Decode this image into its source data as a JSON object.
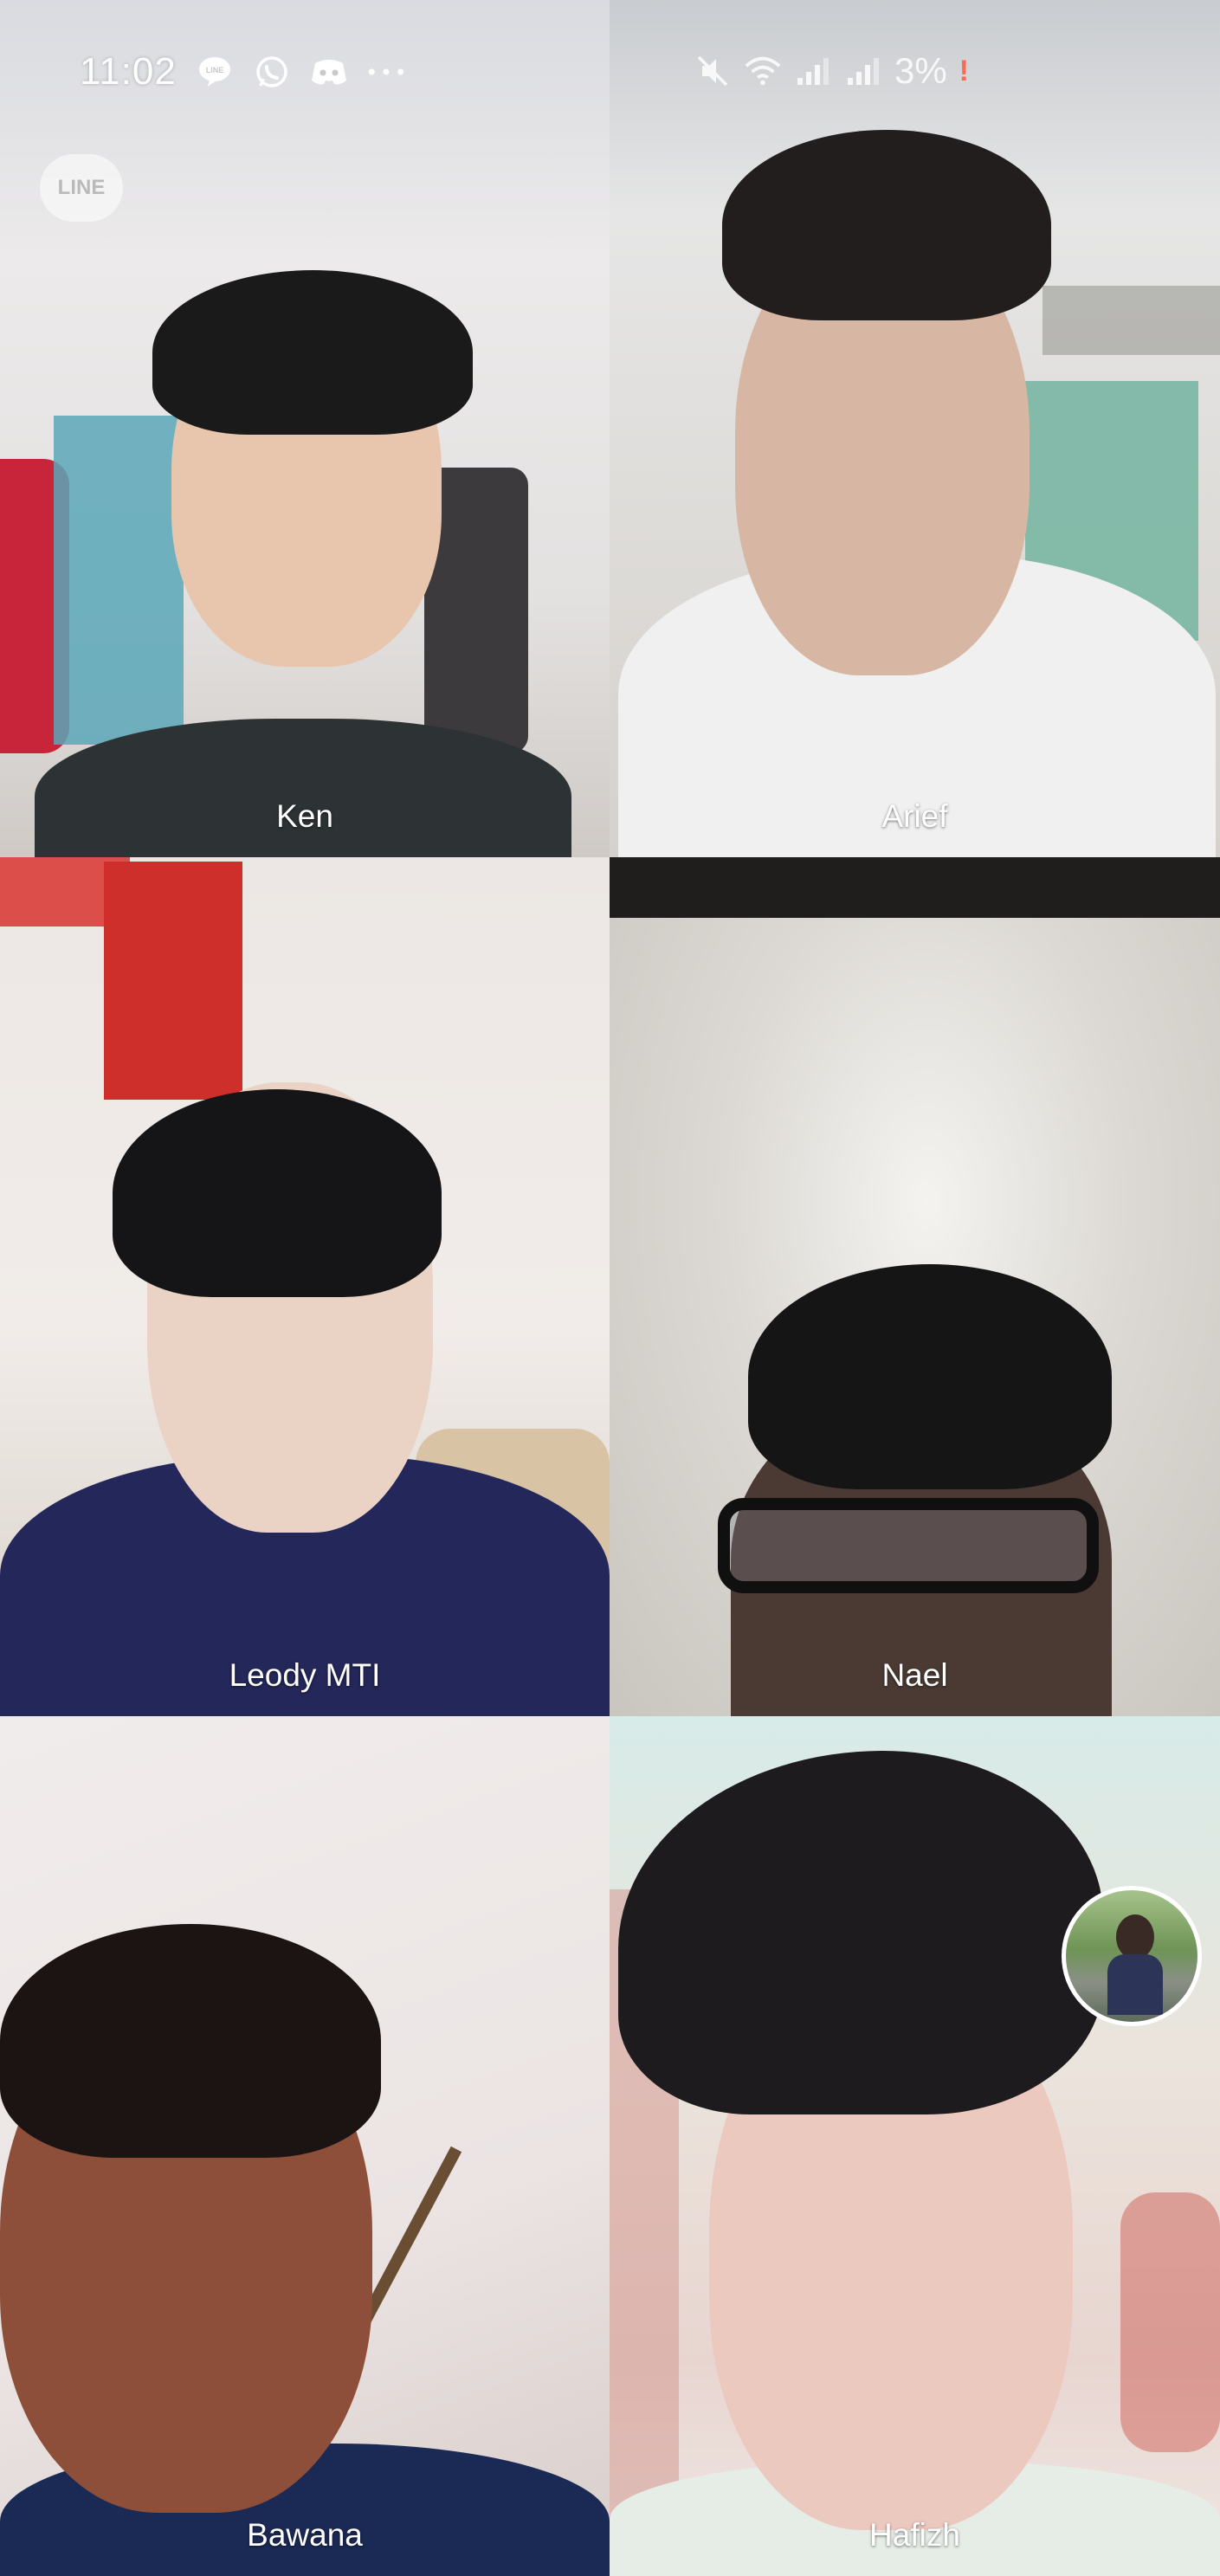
{
  "status_bar": {
    "time": "11:02",
    "left_icons": [
      "line-icon",
      "whatsapp-icon",
      "discord-icon",
      "more-dots-icon"
    ],
    "right_icons": [
      "mute-icon",
      "wifi-icon",
      "signal-icon",
      "signal-icon"
    ],
    "battery_percent": "3%",
    "battery_warning": "!"
  },
  "call": {
    "watermark": "LINE",
    "participants": [
      {
        "name": "Ken"
      },
      {
        "name": "Arief"
      },
      {
        "name": "Leody MTI"
      },
      {
        "name": "Nael"
      },
      {
        "name": "Bawana"
      },
      {
        "name": "Hafizh"
      }
    ]
  },
  "colors": {
    "label_text": "#ffffff",
    "self_preview_border": "#ffffff",
    "battery_warning": "#ff5a3c"
  }
}
